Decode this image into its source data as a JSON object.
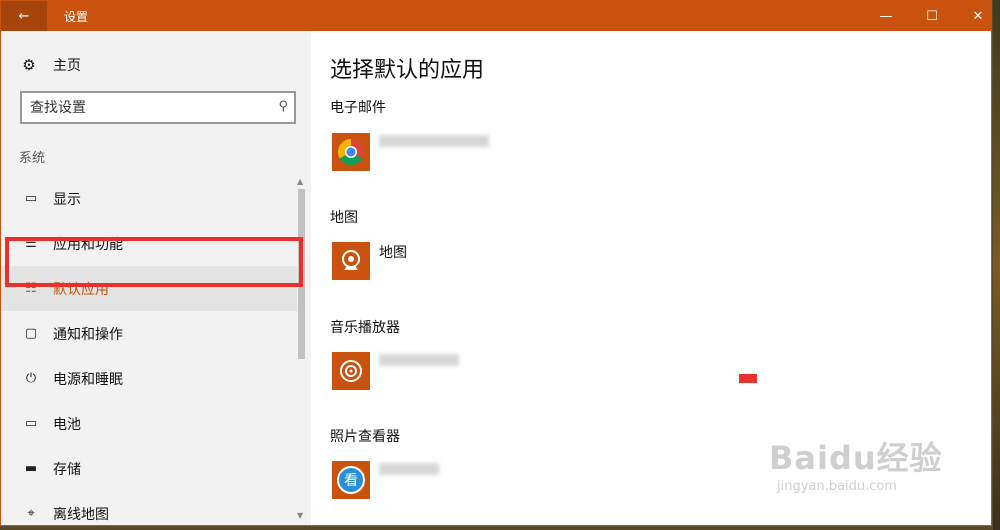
{
  "titlebar": {
    "title": "设置",
    "back_icon": "←",
    "minimize_icon": "—",
    "maximize_icon": "☐",
    "close_icon": "✕",
    "accent_color": "#c8520e"
  },
  "sidebar": {
    "home_label": "主页",
    "home_icon": "⚙",
    "search_placeholder": "查找设置",
    "search_icon": "⚲",
    "section_label": "系统",
    "items": [
      {
        "label": "显示",
        "icon": "▭"
      },
      {
        "label": "应用和功能",
        "icon": "☰"
      },
      {
        "label": "默认应用",
        "icon": "☷",
        "selected": true
      },
      {
        "label": "通知和操作",
        "icon": "▢"
      },
      {
        "label": "电源和睡眠",
        "icon": "⏻"
      },
      {
        "label": "电池",
        "icon": "▭"
      },
      {
        "label": "存储",
        "icon": "▬"
      },
      {
        "label": "离线地图",
        "icon": "⌖"
      }
    ]
  },
  "main": {
    "page_title": "选择默认的应用",
    "categories": [
      {
        "label": "电子邮件",
        "app_name": "",
        "app_icon": "chrome-icon"
      },
      {
        "label": "地图",
        "app_name": "地图",
        "app_icon": "maps-icon"
      },
      {
        "label": "音乐播放器",
        "app_name": "",
        "app_icon": "music-icon"
      },
      {
        "label": "照片查看器",
        "app_name": "",
        "app_icon": "photo-viewer-icon"
      }
    ]
  },
  "watermark": {
    "logo": "Baidu经验",
    "sub": "jingyan.baidu.com"
  }
}
